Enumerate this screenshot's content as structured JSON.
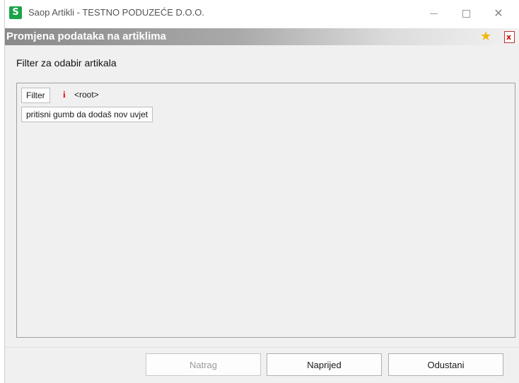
{
  "window": {
    "app_icon_letter": "S",
    "title": "Saop Artikli - TESTNO PODUZEĆE D.O.O.",
    "close_glyph": "✕"
  },
  "header": {
    "title": "Promjena podataka na artiklima",
    "icons": [
      "star-icon",
      "close-document-icon"
    ],
    "star_glyph": "★",
    "close_glyph": "x"
  },
  "main": {
    "section_label": "Filter za odabir artikala",
    "filter_button": "Filter",
    "info_marker": "i",
    "root_label": "<root>",
    "add_condition_button": "pritisni gumb da dodaš nov uvjet"
  },
  "footer": {
    "back_label": "Natrag",
    "next_label": "Naprijed",
    "cancel_label": "Odustani"
  },
  "colors": {
    "app_icon": "#1aa34a",
    "star": "#f2b705",
    "info_marker": "#e00000"
  }
}
